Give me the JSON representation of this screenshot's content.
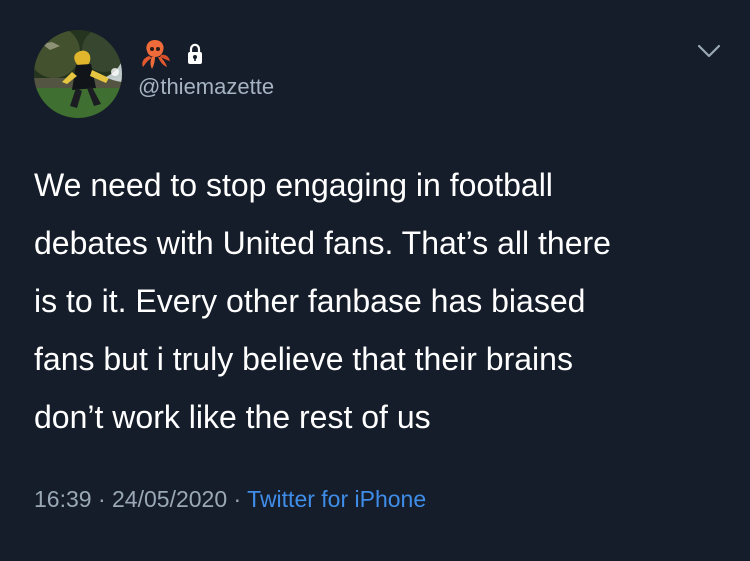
{
  "tweet": {
    "handle": "@thiemazette",
    "name_icons": [
      "squid-emoji-icon",
      "lock-icon"
    ],
    "text_lines": [
      "We need to stop engaging in football",
      "debates with United fans. That’s all there",
      "is to it. Every other fanbase has biased",
      "fans but i truly believe that their brains",
      "don’t work like the rest of us"
    ],
    "time": "16:39",
    "separator": " · ",
    "date": "24/05/2020",
    "source": "Twitter for iPhone"
  },
  "colors": {
    "background": "#151d2a",
    "text": "#ffffff",
    "muted": "#9aa8b6",
    "link": "#3f8de8"
  }
}
